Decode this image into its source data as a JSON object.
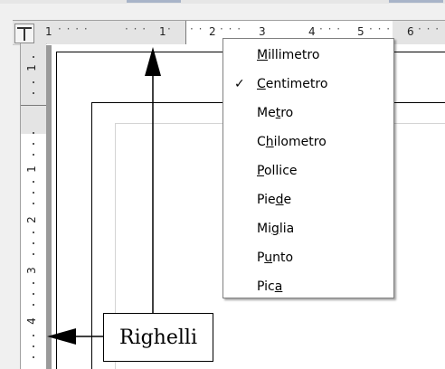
{
  "ruler_h": {
    "numbers": [
      "1",
      "1",
      "2",
      "3",
      "4",
      "5",
      "6"
    ]
  },
  "ruler_v": {
    "numbers": [
      "1",
      "1",
      "2",
      "3",
      "4"
    ]
  },
  "menu": {
    "items": [
      {
        "label": "Millimetro",
        "checked": false,
        "mnemonic": "M"
      },
      {
        "label": "Centimetro",
        "checked": true,
        "mnemonic": "C"
      },
      {
        "label": "Metro",
        "checked": false,
        "mnemonic": "t"
      },
      {
        "label": "Chilometro",
        "checked": false,
        "mnemonic": "h"
      },
      {
        "label": "Pollice",
        "checked": false,
        "mnemonic": "P"
      },
      {
        "label": "Piede",
        "checked": false,
        "mnemonic": "d"
      },
      {
        "label": "Miglia",
        "checked": false,
        "mnemonic": "g"
      },
      {
        "label": "Punto",
        "checked": false,
        "mnemonic": "u"
      },
      {
        "label": "Pica",
        "checked": false,
        "mnemonic": "a"
      }
    ],
    "check_icon": "✓"
  },
  "callout": {
    "label": "Righelli"
  },
  "colors": {
    "ruler_margin": "#e4e4e4",
    "ruler_body": "#ffffff",
    "menu_border": "#808080",
    "background": "#f0f0f0"
  },
  "icons": {
    "tab_selector": "tab-stop-left-icon",
    "check": "check-icon"
  }
}
